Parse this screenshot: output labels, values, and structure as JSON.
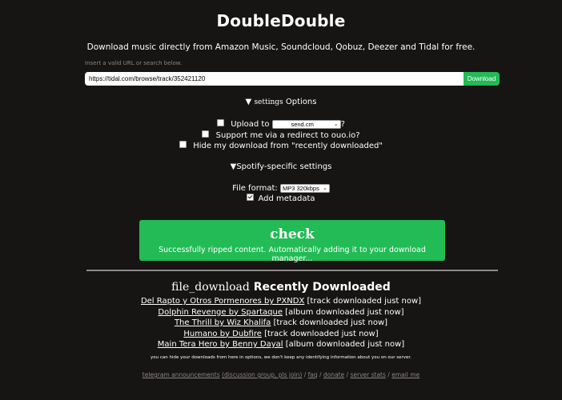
{
  "header": {
    "title": "DoubleDouble",
    "subtitle": "Download music directly from Amazon Music, Soundcloud, Qobuz, Deezer and Tidal for free."
  },
  "search": {
    "hint": "Insert a valid URL or search below.",
    "value": "https://tidal.com/browse/track/352421120",
    "button_label": "Download"
  },
  "options": {
    "summary_icon": "settings",
    "summary_label": "Options",
    "upload_prefix": "Upload to",
    "upload_select_value": "send.cm",
    "upload_suffix": "?",
    "upload_checked": false,
    "support_label": "Support me via a redirect to ouo.io?",
    "support_checked": false,
    "hide_label": "Hide my download from \"recently downloaded\"",
    "hide_checked": false
  },
  "spotify": {
    "summary_label": "Spotify-specific settings",
    "format_label": "File format:",
    "format_value": "MP3 320kbps",
    "metadata_label": "Add metadata",
    "metadata_checked": true
  },
  "status": {
    "icon": "check",
    "message": "Successfully ripped content. Automatically adding it to your download manager...",
    "color": "#22bb55"
  },
  "recent": {
    "icon": "file_download",
    "title": "Recently Downloaded",
    "items": [
      {
        "link": "Del Rapto y Otros Pormenores by PXNDX",
        "meta": "[track downloaded just now]"
      },
      {
        "link": "Dolphin Revenge by Spartaque",
        "meta": "[album downloaded just now]"
      },
      {
        "link": "The Thrill by Wiz Khalifa",
        "meta": "[track downloaded just now]"
      },
      {
        "link": "Humano by Dubfire",
        "meta": "[track downloaded just now]"
      },
      {
        "link": "Main Tera Hero by Benny Dayal",
        "meta": "[album downloaded just now]"
      }
    ],
    "note": "you can hide your downloads from here in options, we don't keep any identifying information about you on our server."
  },
  "footer": {
    "telegram": "telegram announcements",
    "discussion": "(discussion group, pls join)",
    "faq": "faq",
    "donate": "donate",
    "server_stats": "server stats",
    "email": "email me",
    "sep": " / "
  }
}
